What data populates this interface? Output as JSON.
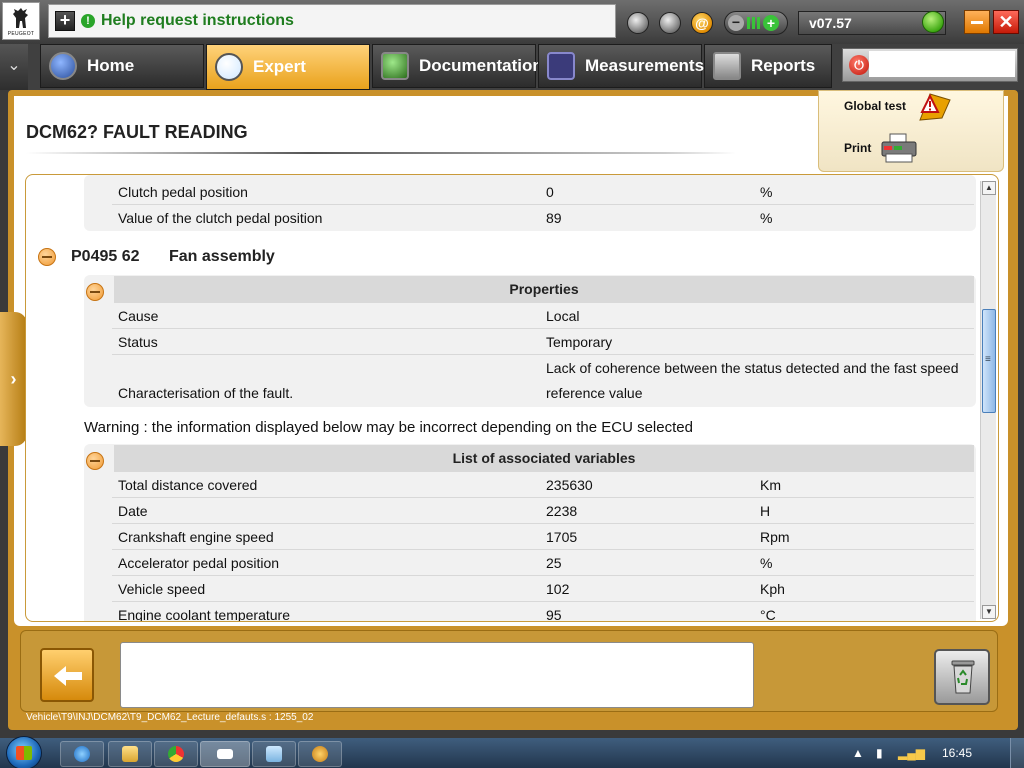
{
  "app": {
    "logo_text": "PEUGEOT",
    "help_title": "Help request instructions",
    "version": "v07.57"
  },
  "tabs": [
    {
      "label": "Home",
      "icon": "home-icon"
    },
    {
      "label": "Expert",
      "icon": "magnifier-icon",
      "active": true
    },
    {
      "label": "Documentation",
      "icon": "documentation-icon"
    },
    {
      "label": "Measurements",
      "icon": "measurements-icon"
    },
    {
      "label": "Reports",
      "icon": "reports-icon"
    }
  ],
  "header": {
    "title": "DCM62?  FAULT READING",
    "global_test_label": "Global test",
    "print_label": "Print"
  },
  "top_rows": [
    {
      "name": "Clutch pedal position",
      "value": "0",
      "unit": "%"
    },
    {
      "name": "Value of the clutch pedal position",
      "value": "89",
      "unit": "%"
    }
  ],
  "fault": {
    "code": "P0495 62",
    "name": "Fan assembly"
  },
  "properties": {
    "header": "Properties",
    "rows": [
      {
        "name": "Cause",
        "value": "Local"
      },
      {
        "name": "Status",
        "value": "Temporary"
      },
      {
        "name": "Characterisation of the fault.",
        "value_line1": "Lack of coherence between the status detected and the fast speed",
        "value_line2": "reference value"
      }
    ]
  },
  "warning": "Warning : the information displayed below may be incorrect depending on the ECU selected",
  "variables": {
    "header": "List of associated variables",
    "rows": [
      {
        "name": "Total distance covered",
        "value": "235630",
        "unit": "Km"
      },
      {
        "name": "Date",
        "value": "2238",
        "unit": "H"
      },
      {
        "name": "Crankshaft engine speed",
        "value": "1705",
        "unit": "Rpm"
      },
      {
        "name": "Accelerator pedal position",
        "value": "25",
        "unit": "%"
      },
      {
        "name": "Vehicle speed",
        "value": "102",
        "unit": "Kph"
      },
      {
        "name": "Engine coolant temperature",
        "value": "95",
        "unit": "°C"
      }
    ]
  },
  "status_path": "Vehicle\\T9\\INJ\\DCM62\\T9_DCM62_Lecture_defauts.s : 1255_02",
  "taskbar": {
    "clock": "16:45"
  },
  "colors": {
    "accent_orange": "#e9a21c",
    "frame_gold": "#c9912a",
    "help_green": "#1f7d1f"
  }
}
